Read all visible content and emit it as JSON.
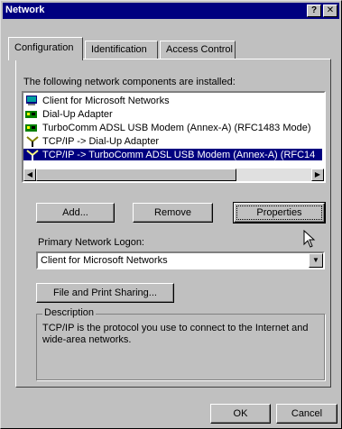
{
  "window": {
    "title": "Network",
    "help_label": "?",
    "close_label": "✕"
  },
  "tabs": [
    {
      "label": "Configuration"
    },
    {
      "label": "Identification"
    },
    {
      "label": "Access Control"
    }
  ],
  "components": {
    "heading": "The following network components are installed:",
    "items": [
      {
        "label": "Client for Microsoft Networks",
        "icon": "client-icon",
        "selected": false
      },
      {
        "label": "Dial-Up Adapter",
        "icon": "adapter-icon",
        "selected": false
      },
      {
        "label": "TurboComm ADSL USB Modem (Annex-A) (RFC1483 Mode)",
        "icon": "adapter-icon",
        "selected": false
      },
      {
        "label": "TCP/IP -> Dial-Up Adapter",
        "icon": "protocol-icon",
        "selected": false
      },
      {
        "label": "TCP/IP -> TurboComm ADSL USB Modem (Annex-A) (RFC14",
        "icon": "protocol-icon",
        "selected": true
      }
    ]
  },
  "buttons": {
    "add": "Add...",
    "remove": "Remove",
    "properties": "Properties",
    "file_print": "File and Print Sharing...",
    "ok": "OK",
    "cancel": "Cancel"
  },
  "logon": {
    "label": "Primary Network Logon:",
    "value": "Client for Microsoft Networks"
  },
  "description": {
    "legend": "Description",
    "text": "TCP/IP is the protocol you use to connect to the Internet and wide-area networks."
  },
  "colors": {
    "face": "#c0c0c0",
    "title_bar": "#000080",
    "selection": "#000080"
  }
}
